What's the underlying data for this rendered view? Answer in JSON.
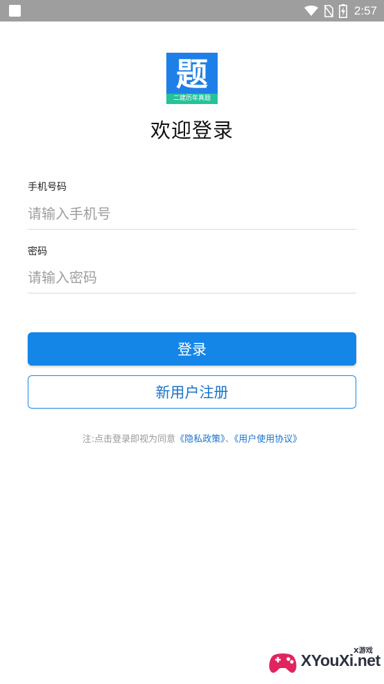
{
  "status_bar": {
    "time": "2:57",
    "icons": [
      "app-notification-icon",
      "wifi-icon",
      "no-sim-icon",
      "battery-charging-icon"
    ]
  },
  "logo": {
    "glyph": "题",
    "caption": "二建历年真题",
    "brand_color": "#1f7fe8",
    "strip_color": "#26c39a"
  },
  "title": "欢迎登录",
  "form": {
    "phone": {
      "label": "手机号码",
      "placeholder": "请输入手机号",
      "value": ""
    },
    "password": {
      "label": "密码",
      "placeholder": "请输入密码",
      "value": ""
    }
  },
  "buttons": {
    "login": "登录",
    "register": "新用户注册",
    "primary_color": "#1486e7"
  },
  "agreement": {
    "prefix": "注:点击登录即视为同意",
    "privacy_link": "《隐私政策》",
    "separator": "、",
    "terms_link": "《用户使用协议》"
  },
  "watermark": {
    "text": "XYouXi.net",
    "sub": "X游戏"
  }
}
